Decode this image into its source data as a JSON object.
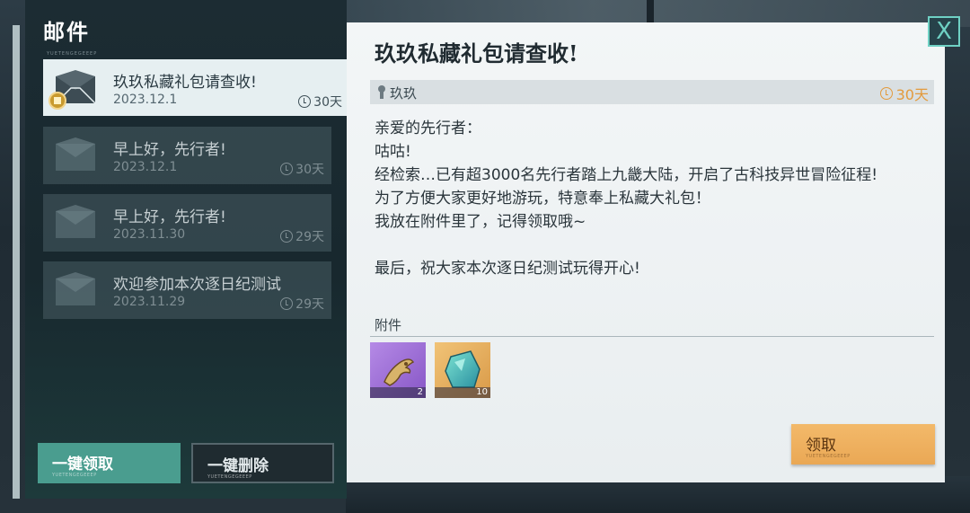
{
  "panel": {
    "title": "邮件",
    "subtitle": "YUETENGEGEEEP"
  },
  "mail_list": [
    {
      "subject": "玖玖私藏礼包请查收!",
      "date": "2023.12.1",
      "days": "30天",
      "selected": true
    },
    {
      "subject": "早上好，先行者!",
      "date": "2023.12.1",
      "days": "30天",
      "selected": false
    },
    {
      "subject": "早上好，先行者!",
      "date": "2023.11.30",
      "days": "29天",
      "selected": false
    },
    {
      "subject": "欢迎参加本次逐日纪测试",
      "date": "2023.11.29",
      "days": "29天",
      "selected": false
    }
  ],
  "buttons": {
    "claim_all": "一键领取",
    "claim_all_sub": "YUETENGEGEEEP",
    "delete_all": "一键删除",
    "delete_all_sub": "YUETENGEGEEEP",
    "claim": "领取",
    "claim_sub": "YUETENGEGEEEP",
    "close": "X"
  },
  "mail": {
    "title": "玖玖私藏礼包请查收!",
    "sender": "玖玖",
    "days": "30天",
    "body": [
      "亲爱的先行者：",
      "咕咕!",
      "经检索…已有超3000名先行者踏上九畿大陆，开启了古科技异世冒险征程!",
      "为了方便大家更好地游玩，特意奉上私藏大礼包！",
      "我放在附件里了，记得领取哦~",
      "",
      "最后，祝大家本次逐日纪测试玩得开心!"
    ],
    "attachments_label": "附件",
    "attachments": [
      {
        "icon": "golden-claw-item-icon",
        "qty": "2"
      },
      {
        "icon": "crystal-stone-item-icon",
        "qty": "10"
      }
    ]
  },
  "colors": {
    "accent_teal": "#4a9d8f",
    "claim_orange": "#eaa855",
    "days_orange": "#e39a3c"
  }
}
